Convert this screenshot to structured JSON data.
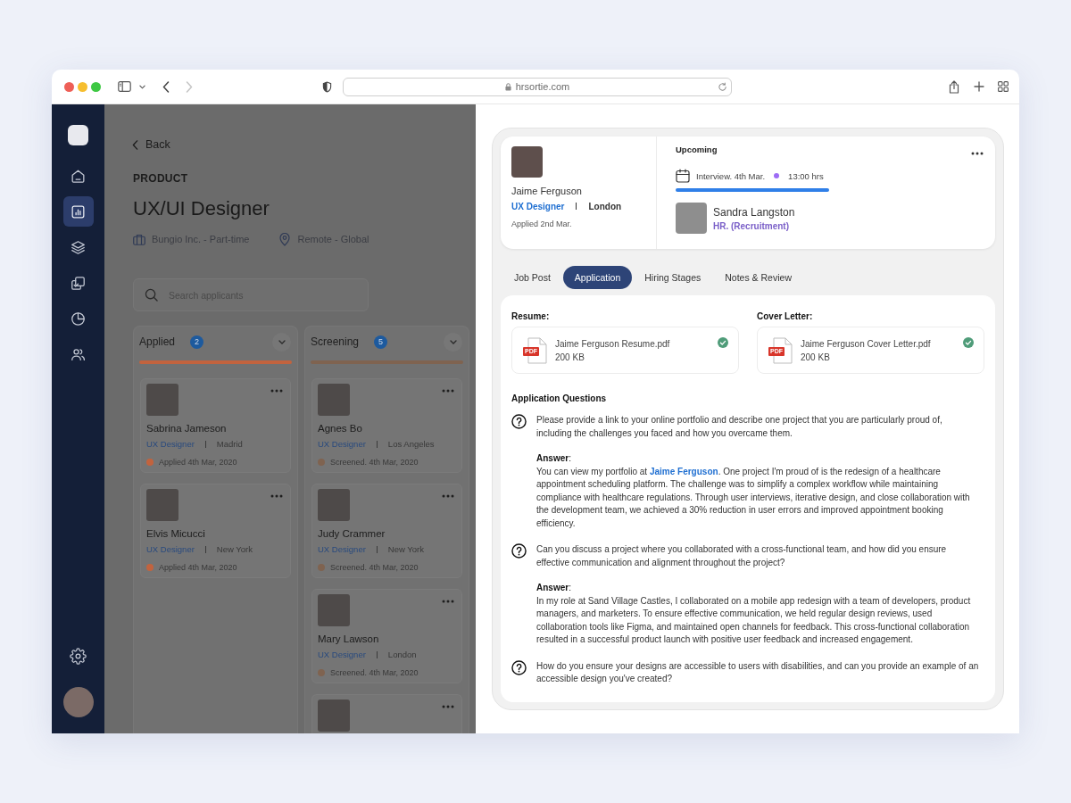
{
  "browser": {
    "url": "hrsortie.com",
    "forward_disabled": true
  },
  "sidebar": {
    "items": [
      {
        "selected": false
      },
      {
        "selected": true
      },
      {
        "selected": false
      },
      {
        "selected": false
      },
      {
        "selected": false
      },
      {
        "selected": false
      }
    ]
  },
  "job": {
    "back": "Back",
    "department": "PRODUCT",
    "title": "UX/UI Designer",
    "company": "Bungio Inc. - Part-time",
    "location": "Remote - Global"
  },
  "search": {
    "placeholder": "Search applicants"
  },
  "columns": [
    {
      "title": "Applied",
      "count": "2",
      "color": "#c2633e",
      "cards": [
        {
          "kind": "candidate",
          "name": "Sabrina Jameson",
          "role": "UX Designer",
          "city": "Madrid",
          "status": "Applied 4th Mar, 2020"
        },
        {
          "kind": "candidate",
          "name": "Elvis Micucci",
          "role": "UX Designer",
          "city": "New York",
          "status": "Applied 4th Mar, 2020"
        }
      ]
    },
    {
      "title": "Screening",
      "count": "5",
      "color": "#7f6350",
      "cards": [
        {
          "kind": "candidate",
          "name": "Agnes Bo",
          "role": "UX Designer",
          "city": "Los Angeles",
          "status": "Screened. 4th Mar, 2020"
        },
        {
          "kind": "candidate",
          "name": "Judy Crammer",
          "role": "UX Designer",
          "city": "New York",
          "status": "Screened. 4th Mar, 2020"
        },
        {
          "kind": "candidate",
          "name": "Mary Lawson",
          "role": "UX Designer",
          "city": "London",
          "status": "Screened. 4th Mar, 2020"
        },
        {
          "kind": "clipped"
        }
      ]
    }
  ],
  "candidate": {
    "name": "Jaime Ferguson",
    "role": "UX Designer",
    "city": "London",
    "applied": "Applied 2nd Mar."
  },
  "upcoming": {
    "heading": "Upcoming",
    "event": "Interview. 4th Mar.",
    "time": "13:00 hrs",
    "interviewer": "Sandra Langston",
    "interviewer_role": "HR. (Recruitment)"
  },
  "tabs": [
    {
      "label": "Job Post",
      "selected": false
    },
    {
      "label": "Application",
      "selected": true
    },
    {
      "label": "Hiring Stages",
      "selected": false
    },
    {
      "label": "Notes & Review",
      "selected": false
    }
  ],
  "documents": [
    {
      "label": "Resume:",
      "file": "Jaime Ferguson Resume.pdf",
      "type": "PDF",
      "size": "200 KB",
      "verified": true
    },
    {
      "label": "Cover Letter:",
      "file": "Jaime Ferguson Cover Letter.pdf",
      "type": "PDF",
      "size": "200 KB",
      "verified": true
    }
  ],
  "questions_heading": "Application Questions",
  "questions": [
    {
      "question": "Please provide a link to your online portfolio and describe one project that you are particularly proud of, including the challenges you faced and how you overcame them.",
      "answer_label": "**Answer**:",
      "answer": [
        {
          "kind": "text",
          "text": "You can view my portfolio at "
        },
        {
          "kind": "link",
          "text": "Jaime Ferguson"
        },
        {
          "kind": "text",
          "text": ". One project I'm proud of is the redesign of a healthcare appointment scheduling platform. The challenge was to simplify a complex workflow while maintaining compliance with healthcare regulations. Through user interviews, iterative design, and close collaboration with the development team, we achieved a 30% reduction in user errors and improved appointment booking efficiency."
        }
      ]
    },
    {
      "question": "Can you discuss a project where you collaborated with a cross-functional team, and how did you ensure effective communication and alignment throughout the project?",
      "answer_label": "**Answer**:",
      "answer": [
        {
          "kind": "text",
          "text": "In my role at Sand Village Castles, I collaborated on a mobile app redesign with a team of developers, product managers, and marketers. To ensure effective communication, we held regular design reviews, used collaboration tools like Figma, and maintained open channels for feedback. This cross-functional collaboration resulted in a successful product launch with positive user feedback and increased engagement."
        }
      ]
    },
    {
      "question": "How do you ensure your designs are accessible to users with disabilities, and can you provide an example of an accessible design you've created?"
    }
  ]
}
